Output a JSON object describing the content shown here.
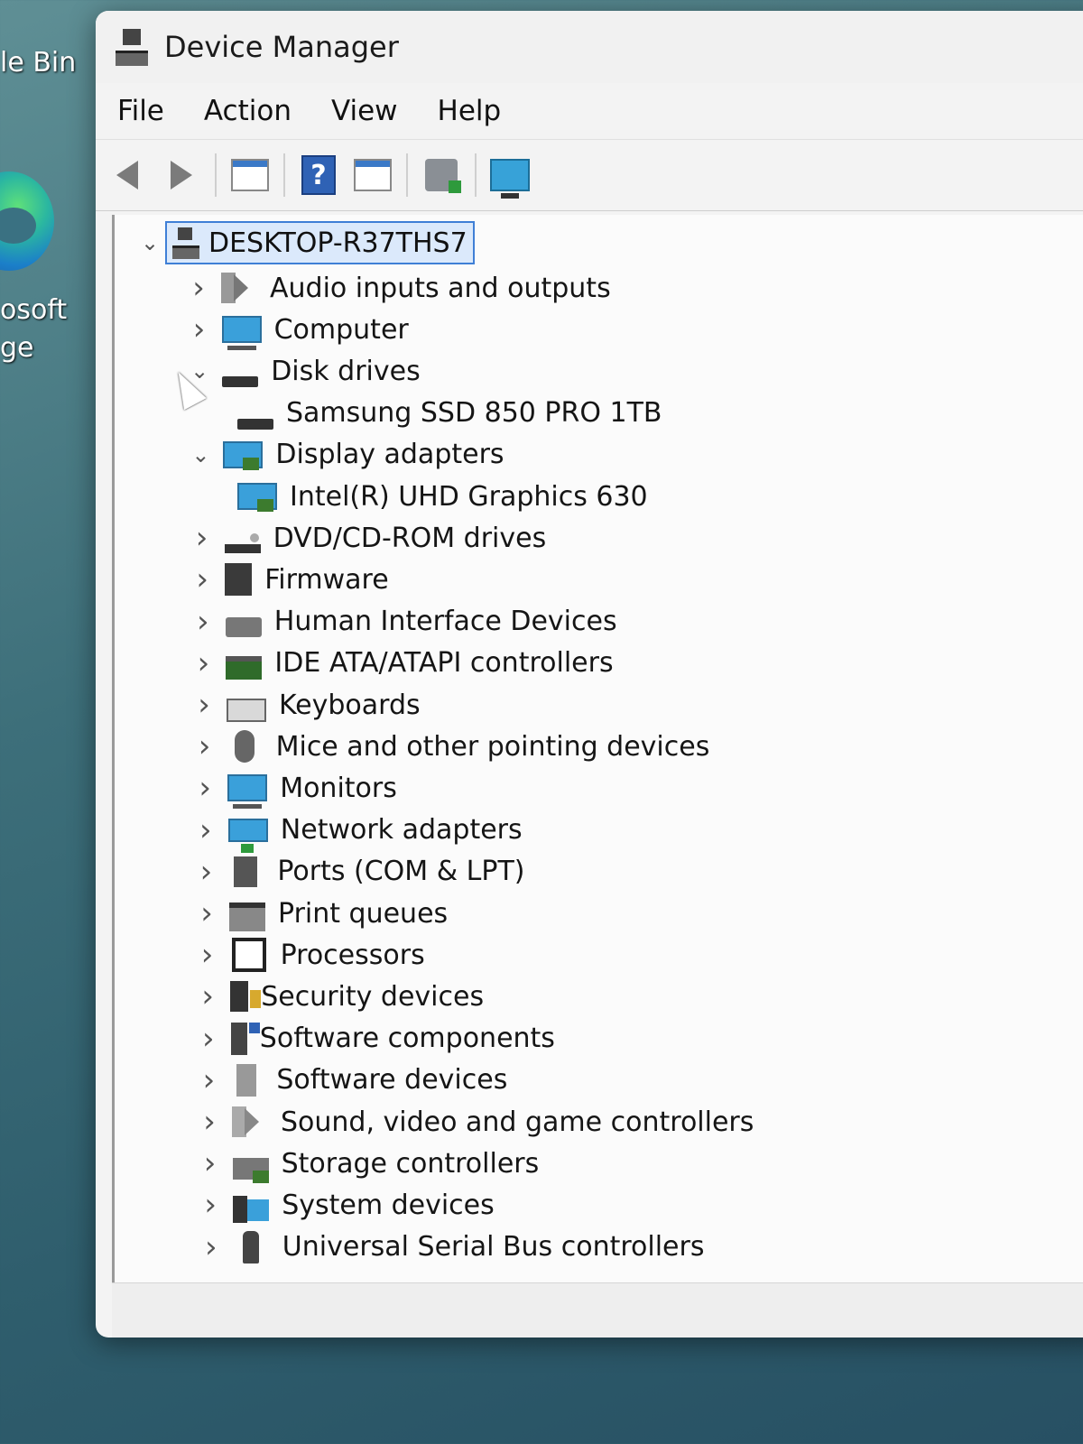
{
  "desktop": {
    "recycle_bin_label": "le Bin",
    "edge_label_line1": "osoft",
    "edge_label_line2": "ge"
  },
  "window": {
    "title": "Device Manager"
  },
  "menu": {
    "file": "File",
    "action": "Action",
    "view": "View",
    "help": "Help"
  },
  "toolbar": {
    "help_glyph": "?"
  },
  "tree": {
    "root": "DESKTOP-R37THS7",
    "items": [
      {
        "label": "Audio inputs and outputs",
        "icon": "speaker-icon",
        "expanded": false
      },
      {
        "label": "Computer",
        "icon": "monitor-icon",
        "expanded": false
      },
      {
        "label": "Disk drives",
        "icon": "disk-drive-icon",
        "expanded": true
      },
      {
        "label": "Samsung SSD 850 PRO 1TB",
        "icon": "disk-drive-icon",
        "child": true
      },
      {
        "label": "Display adapters",
        "icon": "display-adapter-icon",
        "expanded": true
      },
      {
        "label": "Intel(R) UHD Graphics 630",
        "icon": "display-adapter-icon",
        "child": true
      },
      {
        "label": "DVD/CD-ROM drives",
        "icon": "dvd-drive-icon",
        "expanded": false
      },
      {
        "label": "Firmware",
        "icon": "firmware-icon",
        "expanded": false
      },
      {
        "label": "Human Interface Devices",
        "icon": "hid-icon",
        "expanded": false
      },
      {
        "label": "IDE ATA/ATAPI controllers",
        "icon": "ide-controller-icon",
        "expanded": false
      },
      {
        "label": "Keyboards",
        "icon": "keyboard-icon",
        "expanded": false
      },
      {
        "label": "Mice and other pointing devices",
        "icon": "mouse-icon",
        "expanded": false
      },
      {
        "label": "Monitors",
        "icon": "monitor-icon",
        "expanded": false
      },
      {
        "label": "Network adapters",
        "icon": "network-adapter-icon",
        "expanded": false
      },
      {
        "label": "Ports (COM & LPT)",
        "icon": "port-icon",
        "expanded": false
      },
      {
        "label": "Print queues",
        "icon": "printer-icon",
        "expanded": false
      },
      {
        "label": "Processors",
        "icon": "processor-icon",
        "expanded": false
      },
      {
        "label": "Security devices",
        "icon": "security-device-icon",
        "expanded": false
      },
      {
        "label": "Software components",
        "icon": "software-component-icon",
        "expanded": false
      },
      {
        "label": "Software devices",
        "icon": "software-device-icon",
        "expanded": false
      },
      {
        "label": "Sound, video and game controllers",
        "icon": "sound-controller-icon",
        "expanded": false
      },
      {
        "label": "Storage controllers",
        "icon": "storage-controller-icon",
        "expanded": false
      },
      {
        "label": "System devices",
        "icon": "system-devices-icon",
        "expanded": false
      },
      {
        "label": "Universal Serial Bus controllers",
        "icon": "usb-icon",
        "expanded": false
      }
    ]
  }
}
